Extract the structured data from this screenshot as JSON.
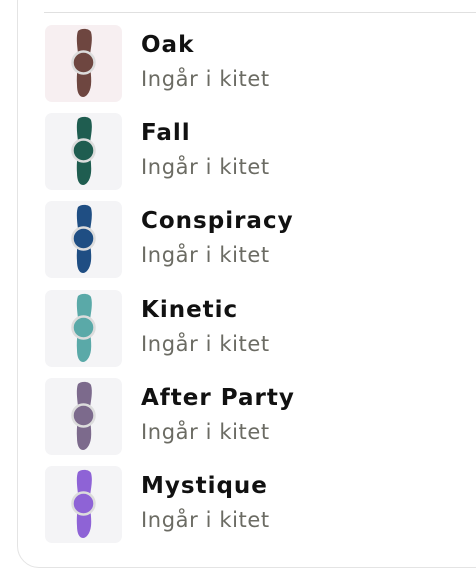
{
  "products": [
    {
      "name": "Oak",
      "status": "Ingår i kitet",
      "swatch_color": "#6e4640",
      "thumb_bg": "pink"
    },
    {
      "name": "Fall",
      "status": "Ingår i kitet",
      "swatch_color": "#1f5d50",
      "thumb_bg": "gray"
    },
    {
      "name": "Conspiracy",
      "status": "Ingår i kitet",
      "swatch_color": "#1f4e83",
      "thumb_bg": "gray"
    },
    {
      "name": "Kinetic",
      "status": "Ingår i kitet",
      "swatch_color": "#5aa9a8",
      "thumb_bg": "gray"
    },
    {
      "name": "After Party",
      "status": "Ingår i kitet",
      "swatch_color": "#7c6a8c",
      "thumb_bg": "gray"
    },
    {
      "name": "Mystique",
      "status": "Ingår i kitet",
      "swatch_color": "#8e63d6",
      "thumb_bg": "gray"
    }
  ]
}
